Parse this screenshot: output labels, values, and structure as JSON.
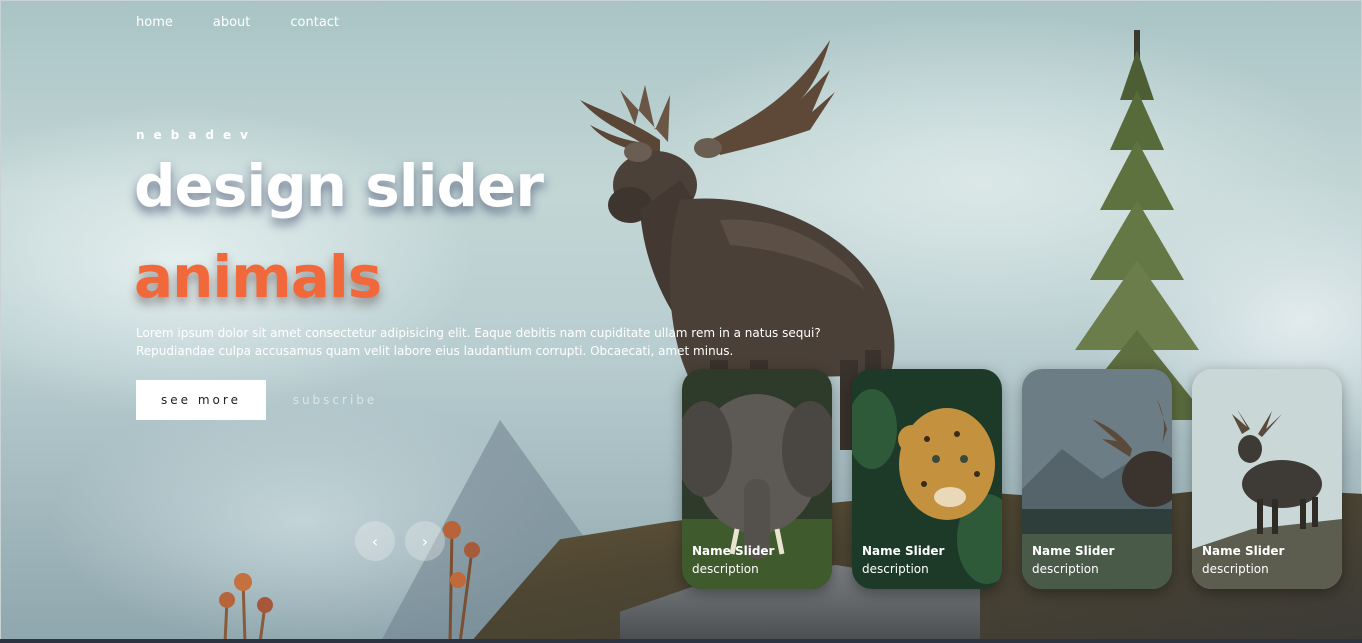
{
  "nav": {
    "items": [
      "home",
      "about",
      "contact"
    ]
  },
  "hero": {
    "author": "nebadev",
    "title": "design slider",
    "topic": "animals",
    "description": "Lorem ipsum dolor sit amet consectetur adipisicing elit. Eaque debitis nam cupiditate ullam rem in a natus sequi? Repudiandae culpa accusamus quam velit labore eius laudantium corrupti. Obcaecati, amet minus.",
    "see_more_label": "see more",
    "subscribe_label": "subscribe"
  },
  "arrows": {
    "prev": "‹",
    "next": "›"
  },
  "thumbnails": [
    {
      "title": "Name Slider",
      "description": "description",
      "subject": "elephant"
    },
    {
      "title": "Name Slider",
      "description": "description",
      "subject": "leopard"
    },
    {
      "title": "Name Slider",
      "description": "description",
      "subject": "moose"
    },
    {
      "title": "Name Slider",
      "description": "description",
      "subject": "moose"
    }
  ],
  "colors": {
    "topic": "#f1683a",
    "button_bg": "#ffffff"
  }
}
